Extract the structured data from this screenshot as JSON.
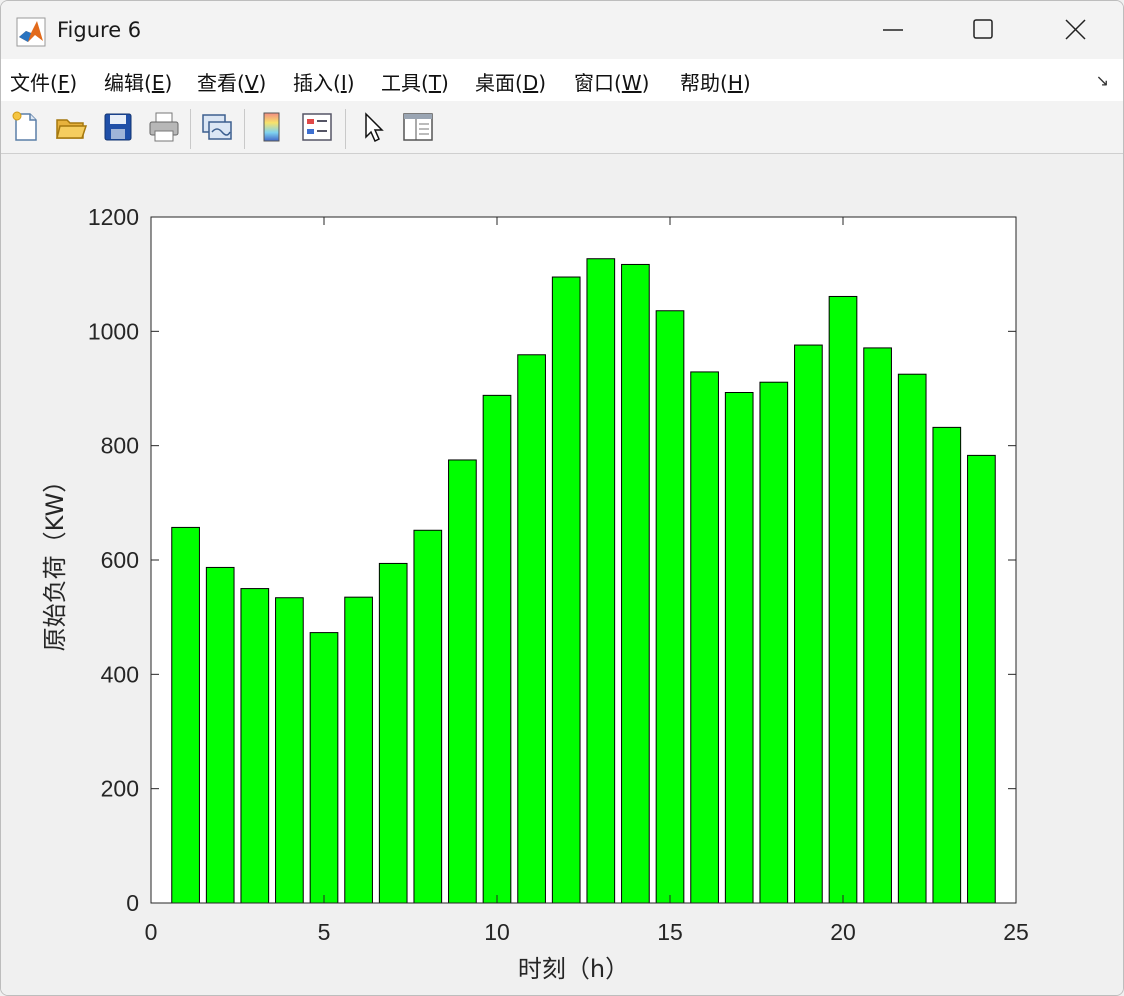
{
  "window": {
    "title": "Figure 6"
  },
  "menu": {
    "items": [
      {
        "label": "文件(",
        "mn": "F",
        "end": ")"
      },
      {
        "label": "编辑(",
        "mn": "E",
        "end": ")"
      },
      {
        "label": "查看(",
        "mn": "V",
        "end": ")"
      },
      {
        "label": "插入(",
        "mn": "I",
        "end": ")"
      },
      {
        "label": "工具(",
        "mn": "T",
        "end": ")"
      },
      {
        "label": "桌面(",
        "mn": "D",
        "end": ")"
      },
      {
        "label": "窗口(",
        "mn": "W",
        "end": ")"
      },
      {
        "label": "帮助(",
        "mn": "H",
        "end": ")"
      }
    ],
    "overflow_glyph": "↘"
  },
  "toolbar": {
    "buttons": [
      "new-figure-icon",
      "open-file-icon",
      "save-icon",
      "print-icon",
      "link-plot-icon",
      "colorbar-icon",
      "legend-icon",
      "pointer-icon",
      "property-editor-icon"
    ]
  },
  "chart_data": {
    "type": "bar",
    "bar_color": "#00ff00",
    "edge_color": "#000000",
    "x": [
      1,
      2,
      3,
      4,
      5,
      6,
      7,
      8,
      9,
      10,
      11,
      12,
      13,
      14,
      15,
      16,
      17,
      18,
      19,
      20,
      21,
      22,
      23,
      24
    ],
    "values": [
      657,
      587,
      550,
      534,
      473,
      535,
      594,
      652,
      775,
      888,
      959,
      1095,
      1127,
      1117,
      1036,
      929,
      893,
      911,
      976,
      1061,
      971,
      925,
      832,
      783
    ],
    "xlim": [
      0,
      25
    ],
    "ylim": [
      0,
      1200
    ],
    "xticks": [
      0,
      5,
      10,
      15,
      20,
      25
    ],
    "yticks": [
      0,
      200,
      400,
      600,
      800,
      1000,
      1200
    ],
    "xlabel": "时刻（h）",
    "ylabel": "原始负荷（KW）",
    "title": ""
  }
}
